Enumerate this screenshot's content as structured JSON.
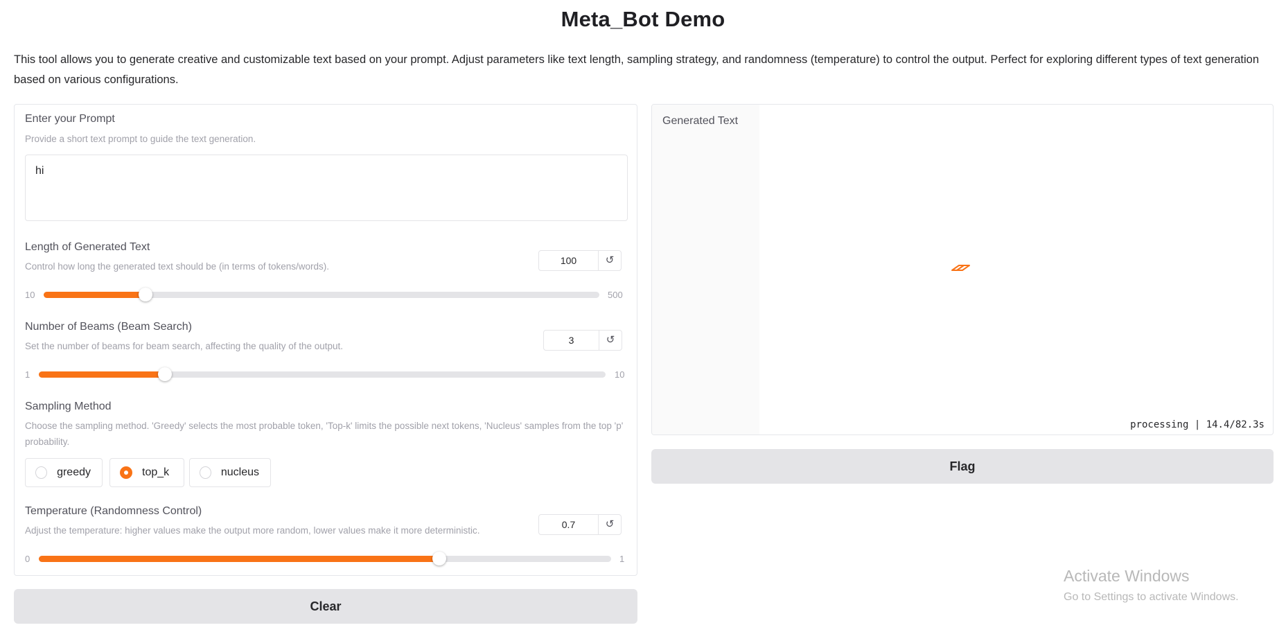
{
  "app": {
    "title": "Meta_Bot Demo",
    "description": "This tool allows you to generate creative and customizable text based on your prompt. Adjust parameters like text length, sampling strategy, and randomness (temperature) to control the output. Perfect for exploring different types of text generation based on various configurations."
  },
  "colors": {
    "accent": "#f97316",
    "button_bg": "#e4e4e7",
    "track": "#e4e4e7"
  },
  "inputs": {
    "prompt": {
      "label": "Enter your Prompt",
      "info": "Provide a short text prompt to guide the text generation.",
      "value": "hi"
    },
    "length": {
      "label": "Length of Generated Text",
      "info": "Control how long the generated text should be (in terms of tokens/words).",
      "value": "100",
      "min": "10",
      "max": "500",
      "value_num": 100,
      "min_num": 10,
      "max_num": 500,
      "reset_icon": "reset-icon"
    },
    "beams": {
      "label": "Number of Beams (Beam Search)",
      "info": "Set the number of beams for beam search, affecting the quality of the output.",
      "value": "3",
      "min": "1",
      "max": "10",
      "value_num": 3,
      "min_num": 1,
      "max_num": 10,
      "reset_icon": "reset-icon"
    },
    "sampling": {
      "label": "Sampling Method",
      "info": "Choose the sampling method. 'Greedy' selects the most probable token, 'Top-k' limits the possible next tokens, 'Nucleus' samples from the top 'p' probability.",
      "options": [
        "greedy",
        "top_k",
        "nucleus"
      ],
      "selected": "top_k"
    },
    "temperature": {
      "label": "Temperature (Randomness Control)",
      "info": "Adjust the temperature: higher values make the output more random, lower values make it more deterministic.",
      "value": "0.7",
      "min": "0",
      "max": "1",
      "value_num": 0.7,
      "min_num": 0,
      "max_num": 1,
      "reset_icon": "reset-icon"
    }
  },
  "buttons": {
    "clear": "Clear",
    "flag": "Flag"
  },
  "output": {
    "label": "Generated Text",
    "status": "processing | 14.4/82.3s",
    "loading_icon": "loading-spinner-icon"
  },
  "watermark": {
    "title": "Activate Windows",
    "subtitle": "Go to Settings to activate Windows."
  }
}
